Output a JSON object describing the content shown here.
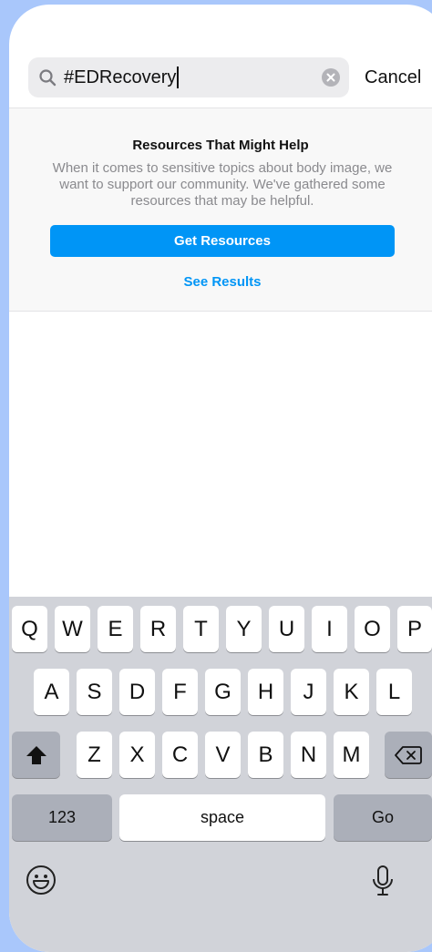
{
  "search": {
    "query": "#EDRecovery",
    "cancel_label": "Cancel"
  },
  "resources": {
    "title": "Resources That Might Help",
    "body": "When it comes to sensitive topics about body image, we want to support our community. We've gathered some resources that may be helpful.",
    "get_label": "Get Resources",
    "see_results_label": "See Results"
  },
  "keyboard": {
    "row1": [
      "Q",
      "W",
      "E",
      "R",
      "T",
      "Y",
      "U",
      "I",
      "O",
      "P"
    ],
    "row2": [
      "A",
      "S",
      "D",
      "F",
      "G",
      "H",
      "J",
      "K",
      "L"
    ],
    "row3": [
      "Z",
      "X",
      "C",
      "V",
      "B",
      "N",
      "M"
    ],
    "numbers_label": "123",
    "space_label": "space",
    "go_label": "Go"
  },
  "colors": {
    "accent": "#0095f6",
    "background": "#a9c7fb",
    "keyboard": "#d1d3d9"
  }
}
